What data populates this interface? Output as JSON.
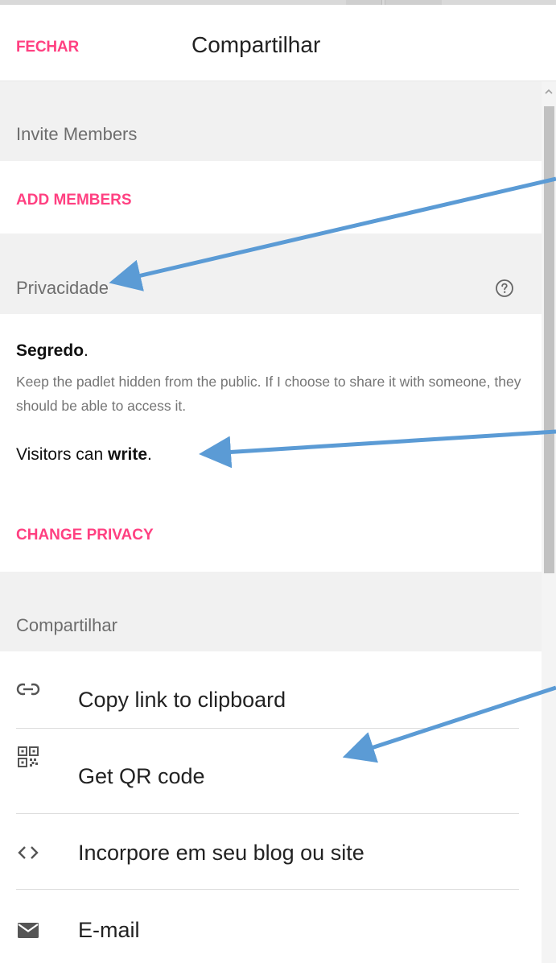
{
  "header": {
    "close_label": "FECHAR",
    "title": "Compartilhar"
  },
  "invite": {
    "section_label": "Invite Members",
    "add_members_label": "ADD MEMBERS"
  },
  "privacy": {
    "section_label": "Privacidade",
    "level_name": "Segredo",
    "level_suffix": ".",
    "description": "Keep the padlet hidden from the public. If I choose to share it with someone, they should be able to access it.",
    "visitors_prefix": "Visitors can ",
    "visitors_permission": "write",
    "visitors_suffix": ".",
    "change_label": "CHANGE PRIVACY"
  },
  "share": {
    "section_label": "Compartilhar",
    "items": [
      {
        "label": "Copy link to clipboard",
        "icon": "link-icon"
      },
      {
        "label": "Get QR code",
        "icon": "qr-code-icon"
      },
      {
        "label": "Incorpore em seu blog ou site",
        "icon": "embed-code-icon"
      },
      {
        "label": "E-mail",
        "icon": "mail-icon"
      }
    ]
  },
  "colors": {
    "accent": "#ff4081",
    "annotation_arrow": "#5b9bd5",
    "section_bg": "#f1f1f1"
  }
}
